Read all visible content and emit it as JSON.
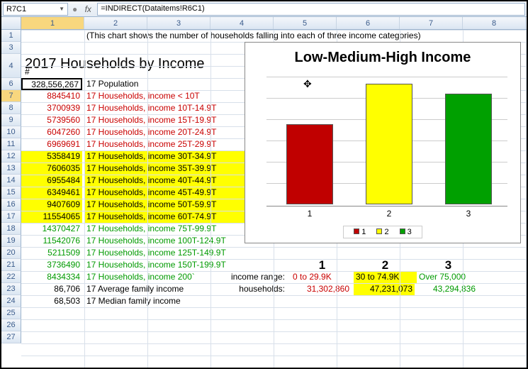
{
  "formula_bar": {
    "name_box": "R7C1",
    "formula": "=INDIRECT(Dataitems!R6C1)"
  },
  "columns": [
    "1",
    "2",
    "3",
    "4",
    "5",
    "6",
    "7",
    "8"
  ],
  "note_row1": "(This chart shows the number of households falling into each of three  income categories)",
  "page_title": "2017 Households by Income",
  "hash": "#",
  "rows": [
    {
      "n": 7,
      "val": "328,556,267",
      "label": "17 Population",
      "sel": true
    },
    {
      "n": 8,
      "val": "8845410",
      "label": "17 Households, income < 10T",
      "class": "r"
    },
    {
      "n": 9,
      "val": "3700939",
      "label": "17 Households, income 10T-14.9T",
      "class": "r"
    },
    {
      "n": 10,
      "val": "5739560",
      "label": "17 Households, income 15T-19.9T",
      "class": "r"
    },
    {
      "n": 11,
      "val": "6047260",
      "label": "17 Households, income 20T-24.9T",
      "class": "r"
    },
    {
      "n": 12,
      "val": "6969691",
      "label": "17 Households, income 25T-29.9T",
      "class": "r"
    },
    {
      "n": 13,
      "val": "5358419",
      "label": "17 Households, income 30T-34.9T",
      "class": "y"
    },
    {
      "n": 14,
      "val": "7606035",
      "label": "17 Households, income 35T-39.9T",
      "class": "y"
    },
    {
      "n": 15,
      "val": "6955484",
      "label": "17 Households, income 40T-44.9T",
      "class": "y"
    },
    {
      "n": 16,
      "val": "6349461",
      "label": "17 Households, income 45T-49.9T",
      "class": "y"
    },
    {
      "n": 17,
      "val": "9407609",
      "label": "17 Households, income 50T-59.9T",
      "class": "y"
    },
    {
      "n": 18,
      "val": "11554065",
      "label": "17 Households, income 60T-74.9T",
      "class": "y"
    },
    {
      "n": 19,
      "val": "14370427",
      "label": "17 Households, income 75T-99.9T",
      "class": "g"
    },
    {
      "n": 20,
      "val": "11542076",
      "label": "17 Households, income 100T-124.9T",
      "class": "g"
    },
    {
      "n": 21,
      "val": "5211509",
      "label": "17 Households, income 125T-149.9T",
      "class": "g"
    },
    {
      "n": 22,
      "val": "3736490",
      "label": "17 Households, income 150T-199.9T",
      "class": "g"
    },
    {
      "n": 23,
      "val": "8434334",
      "label": "17 Households, income 200`",
      "class": "g"
    },
    {
      "n": 24,
      "val": "86,706",
      "label": "17 Average family income"
    },
    {
      "n": 25,
      "val": "68,503",
      "label": "17 Median family income"
    }
  ],
  "summary": {
    "heads": [
      "1",
      "2",
      "3"
    ],
    "range_label": "income range:",
    "hh_label": "households:",
    "ranges": [
      "0 to 29.9K",
      "30 to 74.9K",
      "Over 75,000"
    ],
    "hh": [
      "31,302,860",
      "47,231,073",
      "43,294,836"
    ]
  },
  "chart_data": {
    "type": "bar",
    "title": "Low-Medium-High Income",
    "categories": [
      "1",
      "2",
      "3"
    ],
    "series": [
      {
        "name": "1",
        "color": "#c00000"
      },
      {
        "name": "2",
        "color": "#ffff00"
      },
      {
        "name": "3",
        "color": "#00a000"
      }
    ],
    "values": [
      31302860,
      47231073,
      43294836
    ],
    "ylim": [
      0,
      50000000
    ],
    "legend": [
      "1",
      "2",
      "3"
    ]
  },
  "row_numbers": [
    1,
    3,
    4,
    6,
    7,
    8,
    9,
    10,
    11,
    12,
    13,
    14,
    15,
    16,
    17,
    18,
    19,
    20,
    21,
    22,
    23,
    24,
    25,
    26,
    27
  ]
}
